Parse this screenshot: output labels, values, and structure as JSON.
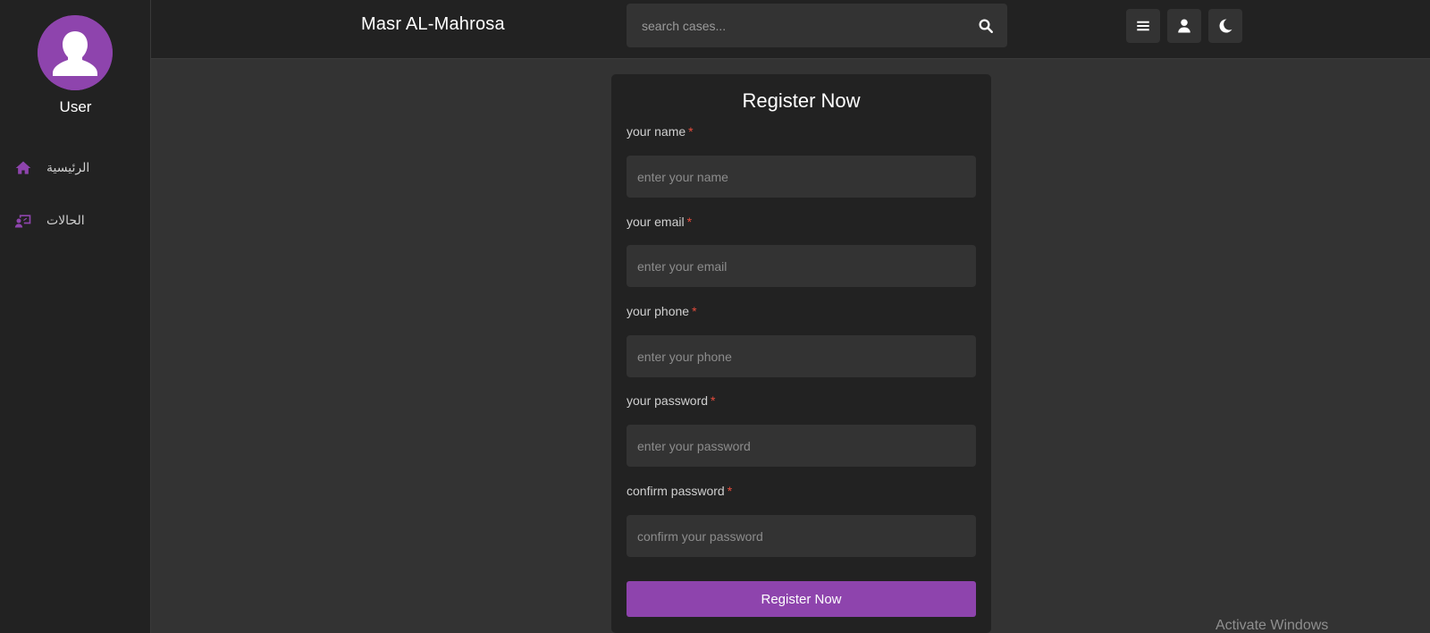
{
  "sidebar": {
    "user_name": "User",
    "avatar_icon": "user-avatar-icon",
    "items": [
      {
        "label": "الرئيسية",
        "icon": "home-icon"
      },
      {
        "label": "الحالات",
        "icon": "cases-icon"
      }
    ]
  },
  "header": {
    "brand": "Masr AL-Mahrosa",
    "search": {
      "placeholder": "search cases...",
      "value": ""
    },
    "buttons": [
      "menu-icon",
      "user-icon",
      "moon-icon"
    ]
  },
  "form": {
    "title": "Register Now",
    "fields": [
      {
        "label": "your name",
        "placeholder": "enter your name",
        "value": "",
        "required": "*"
      },
      {
        "label": "your email",
        "placeholder": "enter your email",
        "value": "",
        "required": "*"
      },
      {
        "label": "your phone",
        "placeholder": "enter your phone",
        "value": "",
        "required": "*"
      },
      {
        "label": "your password",
        "placeholder": "enter your password",
        "value": "",
        "required": "*"
      },
      {
        "label": "confirm password",
        "placeholder": "confirm your password",
        "value": "",
        "required": "*"
      }
    ],
    "submit_label": "Register Now"
  },
  "watermark": "Activate Windows",
  "colors": {
    "accent": "#8e44ad",
    "required": "#e74c3c",
    "panel": "#222222",
    "background": "#333333"
  }
}
